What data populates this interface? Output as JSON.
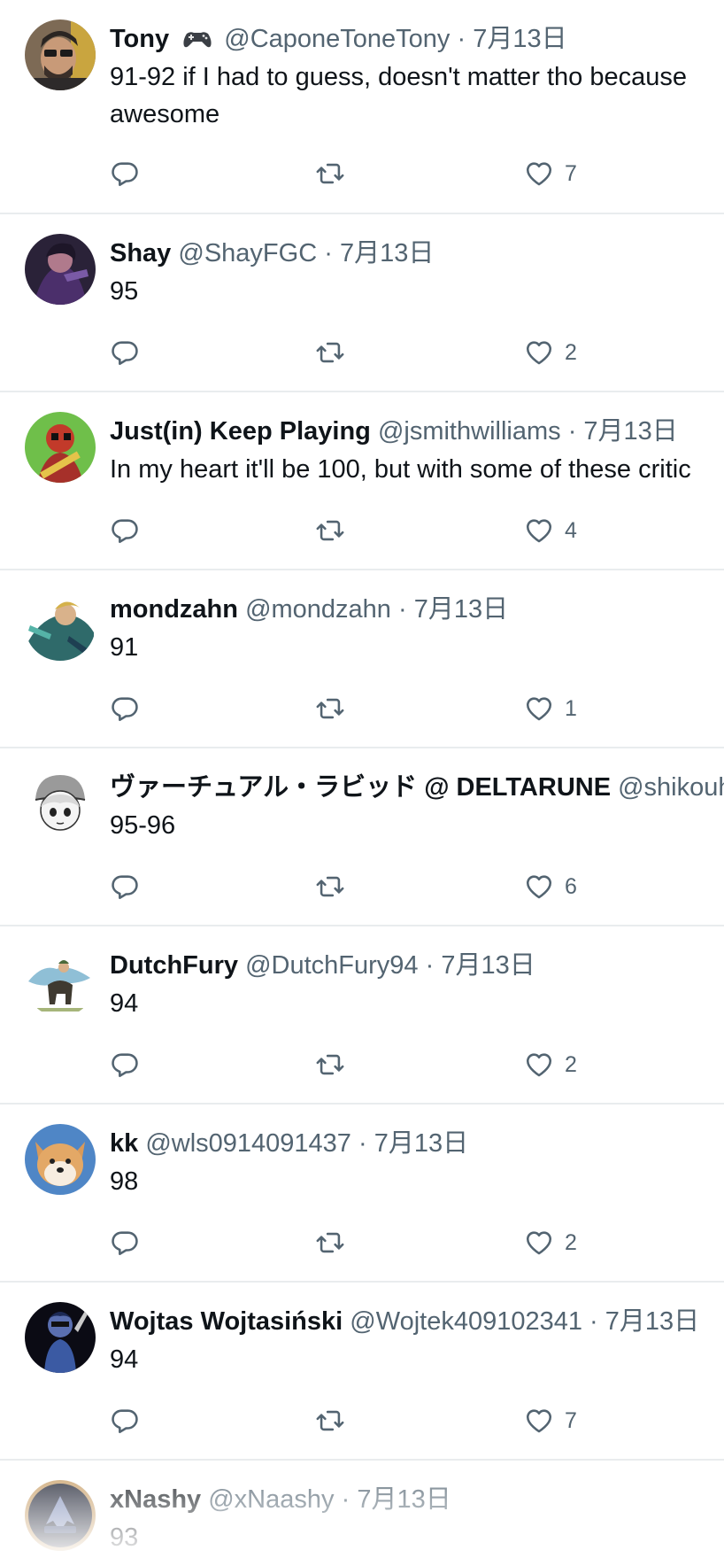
{
  "icons": {
    "reply": "reply-bubble-icon",
    "retweet": "retweet-arrows-icon",
    "like": "heart-icon",
    "game_emoji": "video-game-controller-icon"
  },
  "colors": {
    "text_primary": "#0f1419",
    "text_secondary": "#536471",
    "divider": "#e9ecee"
  },
  "tweets": [
    {
      "name": "Tony",
      "has_emoji": true,
      "handle": "@CaponeToneTony",
      "sep": "·",
      "date": "7月13日",
      "text_lines": [
        "91-92 if I had to guess, doesn't matter tho because",
        "awesome"
      ],
      "likes": "7"
    },
    {
      "name": "Shay",
      "handle": "@ShayFGC",
      "sep": "·",
      "date": "7月13日",
      "text_lines": [
        "95"
      ],
      "likes": "2"
    },
    {
      "name": "Just(in) Keep Playing",
      "handle": "@jsmithwilliams",
      "sep": "·",
      "date": "7月13日",
      "text_lines": [
        "In my heart it'll be 100, but with some of these critic"
      ],
      "likes": "4"
    },
    {
      "name": "mondzahn",
      "handle": "@mondzahn",
      "sep": "·",
      "date": "7月13日",
      "text_lines": [
        "91"
      ],
      "likes": "1"
    },
    {
      "name": "ヴァーチュアル・ラビッド @ DELTARUNE",
      "handle": "@shikouh",
      "sep": "",
      "date": "",
      "text_lines": [
        "95-96"
      ],
      "likes": "6"
    },
    {
      "name": "DutchFury",
      "handle": "@DutchFury94",
      "sep": "·",
      "date": "7月13日",
      "text_lines": [
        "94"
      ],
      "likes": "2"
    },
    {
      "name": "kk",
      "handle": "@wls0914091437",
      "sep": "·",
      "date": "7月13日",
      "text_lines": [
        "98"
      ],
      "likes": "2"
    },
    {
      "name": "Wojtas Wojtasiński",
      "handle": "@Wojtek409102341",
      "sep": "·",
      "date": "7月13日",
      "text_lines": [
        "94"
      ],
      "likes": "7"
    },
    {
      "name": "xNashy",
      "handle": "@xNaashy",
      "sep": "·",
      "date": "7月13日",
      "text_lines": [
        "93"
      ],
      "likes": ""
    }
  ]
}
